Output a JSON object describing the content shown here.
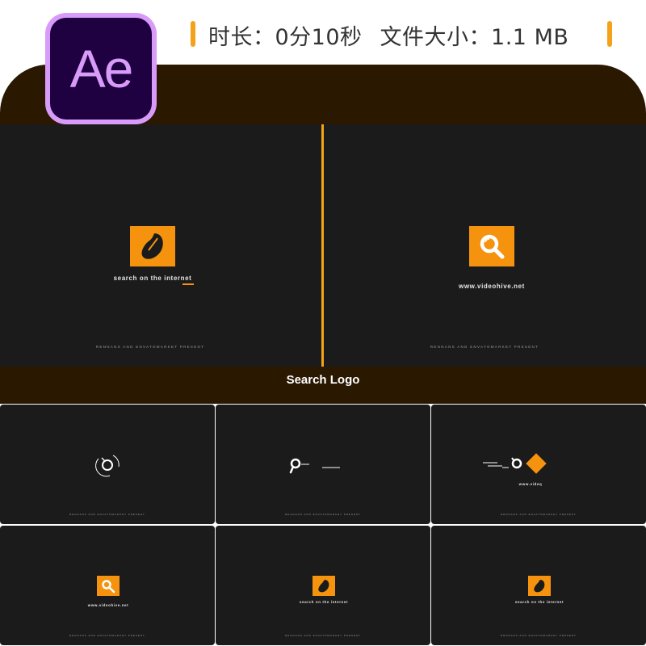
{
  "header": {
    "duration": "时长：0分10秒",
    "file_size": "文件大小：1.1 MB"
  },
  "app_logo": {
    "text": "Ae",
    "fg": "#d89bf9",
    "bg": "#1f0040"
  },
  "caption": "Search Logo",
  "colors": {
    "accent": "#f5930f",
    "panel": "#2a1800",
    "screen": "#1b1b1b"
  },
  "preview": {
    "left": {
      "tagline": "search on the internet",
      "footer": "RENNANS AND ENVATOMARKET PRESENT",
      "icon": "leaf-logo-icon"
    },
    "right": {
      "tagline": "www.videohive.net",
      "footer": "RENNANS AND ENVATOMARKET PRESENT",
      "icon": "magnifier-logo-icon"
    }
  },
  "thumbnails": [
    {
      "tagline": "",
      "footer": "RENNANS AND ENVATOMARKET PRESENT",
      "icon": "rotating-lens-icon"
    },
    {
      "tagline": "",
      "footer": "RENNANS AND ENVATOMARKET PRESENT",
      "icon": "lens-dash-icon"
    },
    {
      "tagline": "www.videq",
      "footer": "RENNANS AND ENVATOMARKET PRESENT",
      "icon": "lens-diamond-icon"
    },
    {
      "tagline": "www.videohive.net",
      "footer": "RENNANS AND ENVATOMARKET PRESENT",
      "icon": "magnifier-logo-icon"
    },
    {
      "tagline": "search on the internet",
      "footer": "RENNANS AND ENVATOMARKET PRESENT",
      "icon": "leaf-logo-icon"
    },
    {
      "tagline": "search on the internet",
      "footer": "RENNANS AND ENVATOMARKET PRESENT",
      "icon": "leaf-logo-icon"
    }
  ]
}
